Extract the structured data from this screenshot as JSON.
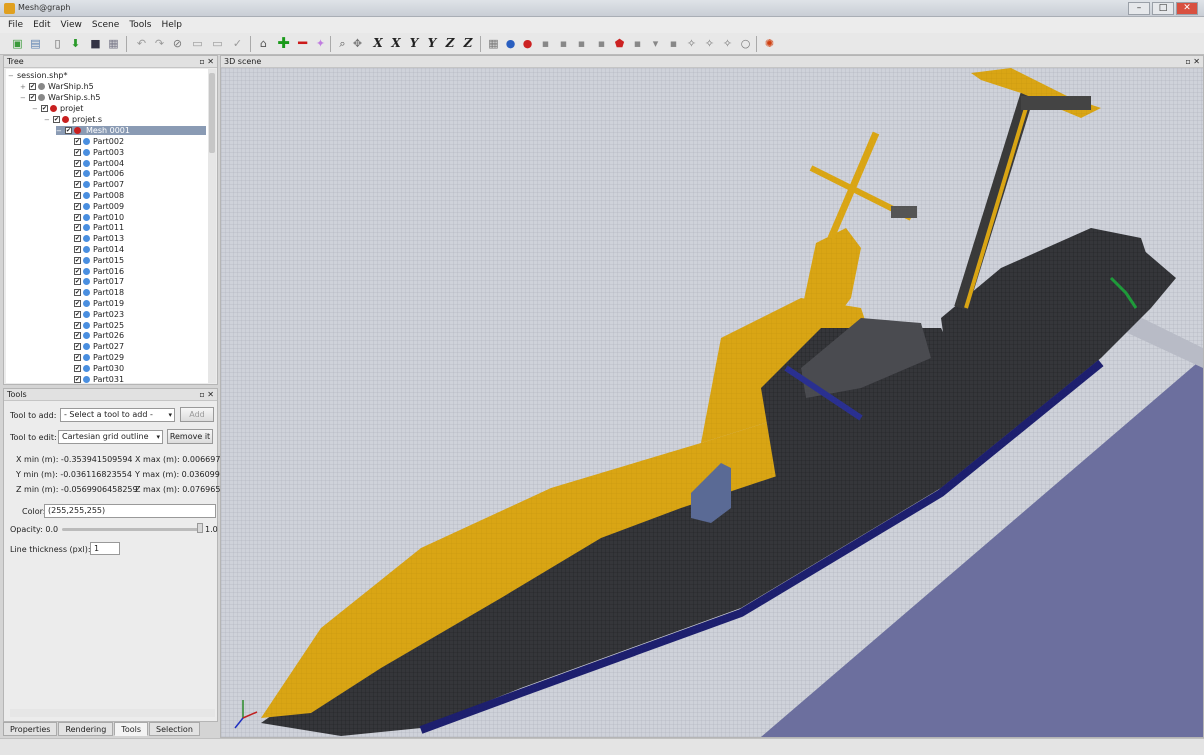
{
  "window": {
    "title": "Mesh@graph"
  },
  "menu": [
    "File",
    "Edit",
    "View",
    "Scene",
    "Tools",
    "Help"
  ],
  "tree_panel": {
    "title": "Tree"
  },
  "tree": {
    "session": "session.shp*",
    "file1": "WarShip.h5",
    "file2": "WarShip.s.h5",
    "projet": "projet",
    "projet_s": "projet.s",
    "mesh": "Mesh 0001",
    "parts": [
      "Part002",
      "Part003",
      "Part004",
      "Part006",
      "Part007",
      "Part008",
      "Part009",
      "Part010",
      "Part011",
      "Part013",
      "Part014",
      "Part015",
      "Part016",
      "Part017",
      "Part018",
      "Part019",
      "Part023",
      "Part025",
      "Part026",
      "Part027",
      "Part029",
      "Part030",
      "Part031"
    ]
  },
  "tools_panel": {
    "title": "Tools",
    "tool_to_add_label": "Tool to add:",
    "tool_to_add_value": "- Select a tool to add -",
    "add_button": "Add",
    "tool_to_edit_label": "Tool to edit:",
    "tool_to_edit_value": "Cartesian grid outline",
    "remove_button": "Remove it",
    "xmin": "X min (m): -0.35394150959​4",
    "xmax": "X max (m): 0.006697",
    "ymin": "Y min (m): -0.036116823554",
    "ymax": "Y max (m): 0.036099",
    "zmin": "Z min (m): -0.0569906458259",
    "zmax": "Z max (m): 0.076965",
    "color_label": "Color:",
    "color_value": "(255,255,255)",
    "opacity_label": "Opacity: 0.0",
    "opacity_max": "1.0",
    "line_thickness_label": "Line thickness (pxl):",
    "line_thickness_value": "1"
  },
  "bottom_tabs": [
    "Properties",
    "Rendering",
    "Tools",
    "Selection"
  ],
  "scene_panel": {
    "title": "3D scene"
  },
  "colors": {
    "ship_yellow": "#d9a514",
    "ship_dark": "#2e2e30",
    "keel_blue": "#1d1f6e",
    "grid_bg": "#c6cad3",
    "floor": "#6e70a0"
  }
}
